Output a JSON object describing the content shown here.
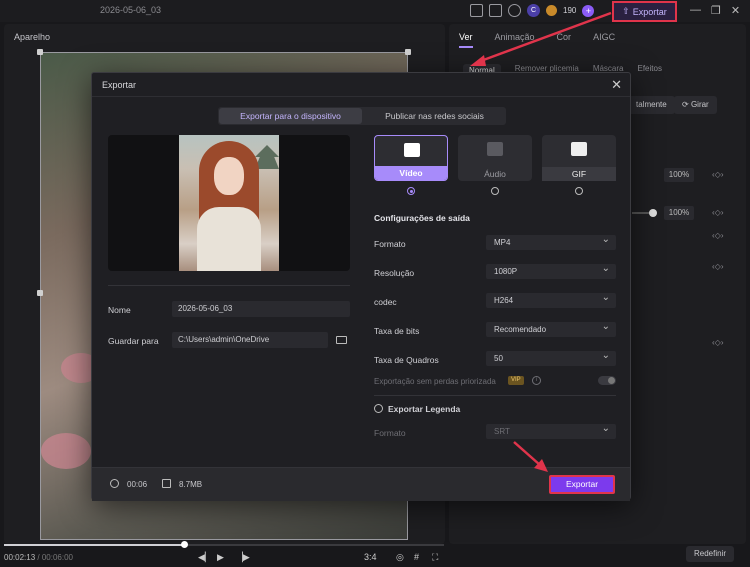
{
  "titlebar": {
    "project_name": "2026-05-06_03",
    "avatar_letter": "C",
    "credits": "190",
    "plus": "+",
    "export_label": "Exportar"
  },
  "preview": {
    "label": "Aparelho"
  },
  "playback": {
    "current_time": "00:02:13",
    "total_time": "/ 00:06:00",
    "aspect": "3:4"
  },
  "properties": {
    "tabs": [
      "Ver",
      "Animação",
      "Cor",
      "AIGC"
    ],
    "active_tab": "Ver",
    "sub_tabs": [
      "Normal",
      "Remover plicemia",
      "Máscara",
      "Efeitos"
    ],
    "btn_horizontal": "talmente",
    "btn_rotate": "Girar",
    "scale_value_1": "100%",
    "scale_value_2": "100%",
    "reset_label": "Redefinir"
  },
  "modal": {
    "title": "Exportar",
    "tabs": [
      "Exportar para o dispositivo",
      "Publicar nas redes sociais"
    ],
    "active_tab": "Exportar para o dispositivo",
    "name_label": "Nome",
    "name_value": "2026-05-06_03",
    "save_label": "Guardar para",
    "save_value": "C:\\Users\\admin\\OneDrive",
    "formats": [
      {
        "name": "Vídeo",
        "selected": true
      },
      {
        "name": "Áudio",
        "selected": false
      },
      {
        "name": "GIF",
        "selected": false
      }
    ],
    "config_title": "Configurações de saída",
    "config": [
      {
        "label": "Formato",
        "value": "MP4"
      },
      {
        "label": "Resolução",
        "value": "1080P"
      },
      {
        "label": "codec",
        "value": "H264"
      },
      {
        "label": "Taxa de bits",
        "value": "Recomendado"
      },
      {
        "label": "Taxa de Quadros",
        "value": "50"
      }
    ],
    "lossless_label": "Exportação sem perdas priorizada",
    "vip_badge": "VIP",
    "subtitle_label": "Exportar Legenda",
    "subtitle_format_label": "Formato",
    "subtitle_format_value": "SRT",
    "duration": "00:06",
    "size": "8.7MB",
    "export_button": "Exportar"
  },
  "colors": {
    "accent": "#a78bfa",
    "export_button": "#7c3aed",
    "annotation": "#e0344b"
  }
}
